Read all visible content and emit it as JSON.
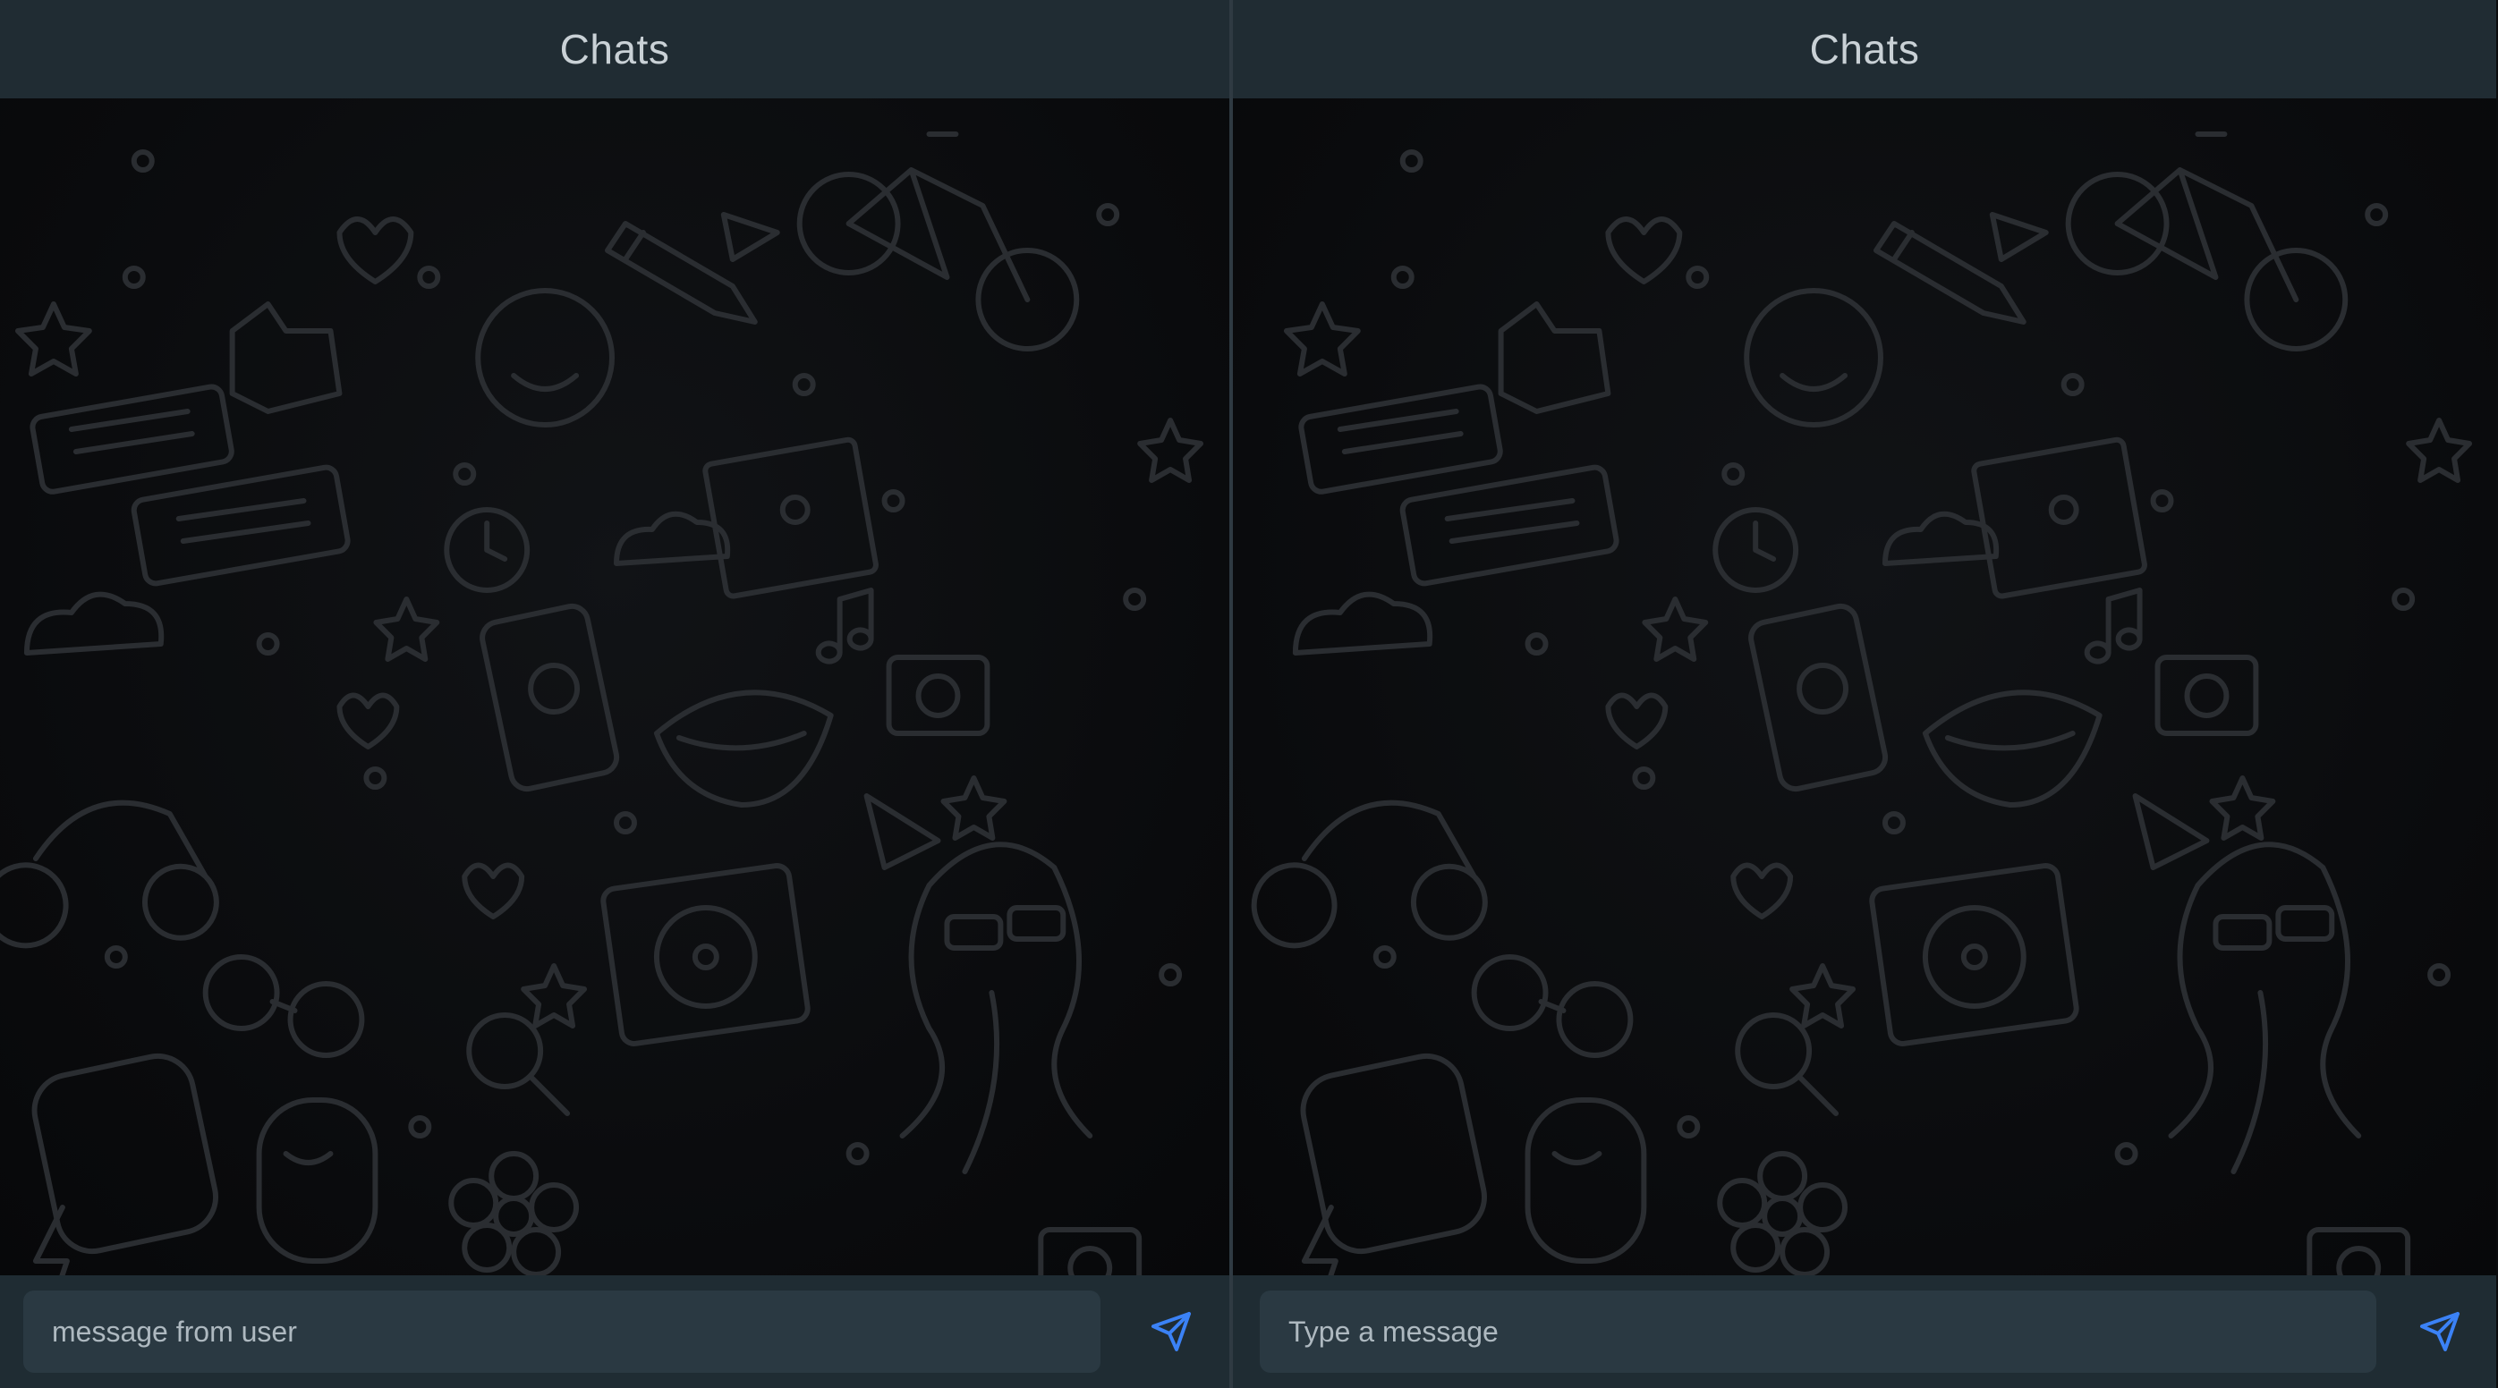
{
  "panes": [
    {
      "header": {
        "title": "Chats"
      },
      "composer": {
        "input_text": "message from user",
        "send_icon": "send-icon"
      }
    },
    {
      "header": {
        "title": "Chats"
      },
      "composer": {
        "input_text": "Type a message",
        "send_icon": "send-icon"
      }
    }
  ],
  "colors": {
    "header_bg": "#202c33",
    "chat_bg": "#0b0c0e",
    "composer_bg": "#1f2c33",
    "input_bg": "#2a3942",
    "send_icon": "#3b82f6",
    "wallpaper_doodle": "#2a2d31"
  }
}
